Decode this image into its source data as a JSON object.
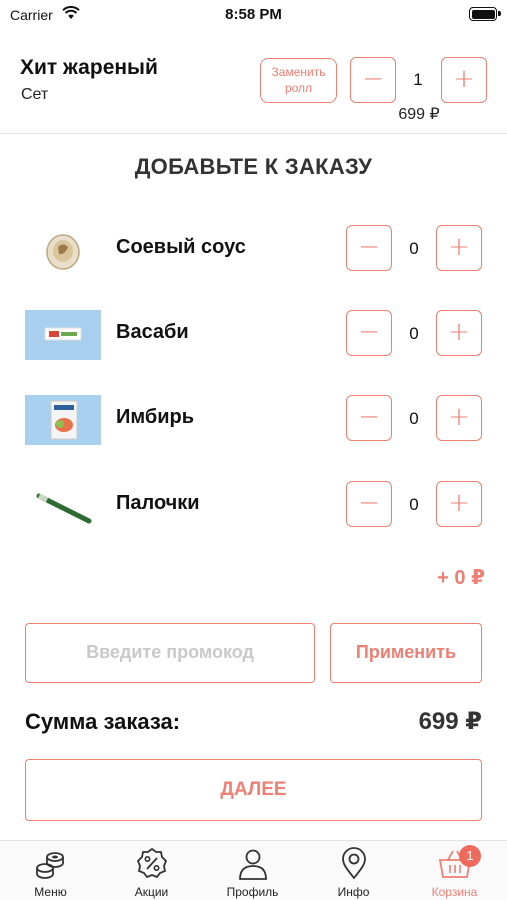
{
  "status_bar": {
    "carrier": "Carrier",
    "time": "8:58 PM"
  },
  "main_item": {
    "name": "Хит жареный",
    "subtitle": "Сет",
    "replace_label": "Заменить ролл",
    "quantity": "1",
    "price": "699 ₽"
  },
  "add_section": {
    "title": "ДОБАВЬТЕ К ЗАКАЗУ",
    "items": [
      {
        "label": "Соевый соус",
        "quantity": "0",
        "thumb": "soy-sauce"
      },
      {
        "label": "Васаби",
        "quantity": "0",
        "thumb": "wasabi"
      },
      {
        "label": "Имбирь",
        "quantity": "0",
        "thumb": "ginger"
      },
      {
        "label": "Палочки",
        "quantity": "0",
        "thumb": "chopsticks"
      }
    ],
    "total": "+ 0 ₽"
  },
  "promo": {
    "placeholder": "Введите промокод",
    "apply_label": "Применить"
  },
  "summary": {
    "label": "Сумма заказа:",
    "value": "699 ₽"
  },
  "next_label": "ДАЛЕЕ",
  "tabbar": {
    "tabs": [
      {
        "label": "Меню",
        "icon": "rolls-icon"
      },
      {
        "label": "Акции",
        "icon": "percent-icon"
      },
      {
        "label": "Профиль",
        "icon": "person-icon"
      },
      {
        "label": "Инфо",
        "icon": "location-icon"
      },
      {
        "label": "Корзина",
        "icon": "basket-icon",
        "badge": "1",
        "active": true
      }
    ]
  },
  "colors": {
    "accent": "#ee7f73",
    "badge": "#ee6a5e",
    "divider": "#f1e4e0"
  },
  "minus_symbol": "−",
  "plus_symbol": "+"
}
